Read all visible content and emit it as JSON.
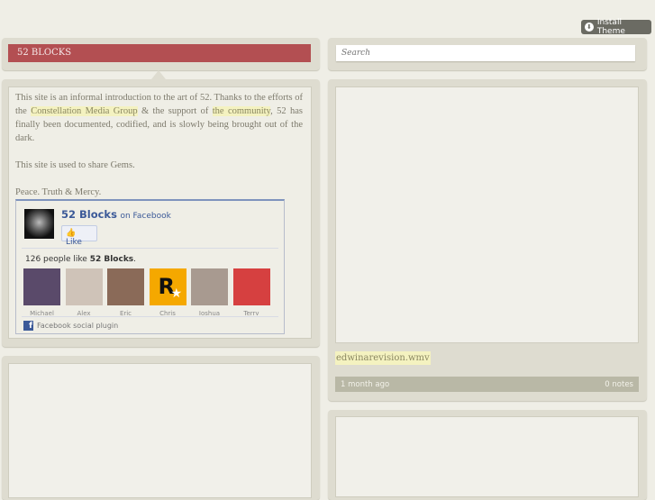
{
  "install_theme": {
    "label": "Install Theme",
    "icon": "download-icon"
  },
  "blog": {
    "title": "52 BLOCKS"
  },
  "description": {
    "p1_before": "This site is an informal introduction to the art of 52. Thanks to the efforts of the ",
    "link1": "Constellation Media Group",
    "p1_mid": " & the support of ",
    "link2": "the community",
    "p1_after": ", 52 has finally been documented, codified, and is slowly being brought out of the dark.",
    "p2": "This site is used to share Gems.",
    "p3": "Peace. Truth & Mercy."
  },
  "facebook": {
    "page_name": "52 Blocks",
    "on_facebook": "on Facebook",
    "like_label": "Like",
    "count_prefix": "126 people like ",
    "count_name": "52 Blocks",
    "count_suffix": ".",
    "fans": [
      {
        "name": "Michael",
        "color": "#5a4a6a"
      },
      {
        "name": "Alex",
        "color": "#cfc3b8"
      },
      {
        "name": "Eric",
        "color": "#8a6a58"
      },
      {
        "name": "Chris",
        "color": "#f5a800"
      },
      {
        "name": "Joshua",
        "color": "#a89a90"
      },
      {
        "name": "Terry",
        "color": "#d64040"
      }
    ],
    "footer": "Facebook social plugin",
    "footer_icon": "f"
  },
  "search": {
    "placeholder": "Search"
  },
  "post": {
    "caption": "edwinarevision.wmv",
    "time": "1 month ago",
    "notes": "0 notes"
  }
}
